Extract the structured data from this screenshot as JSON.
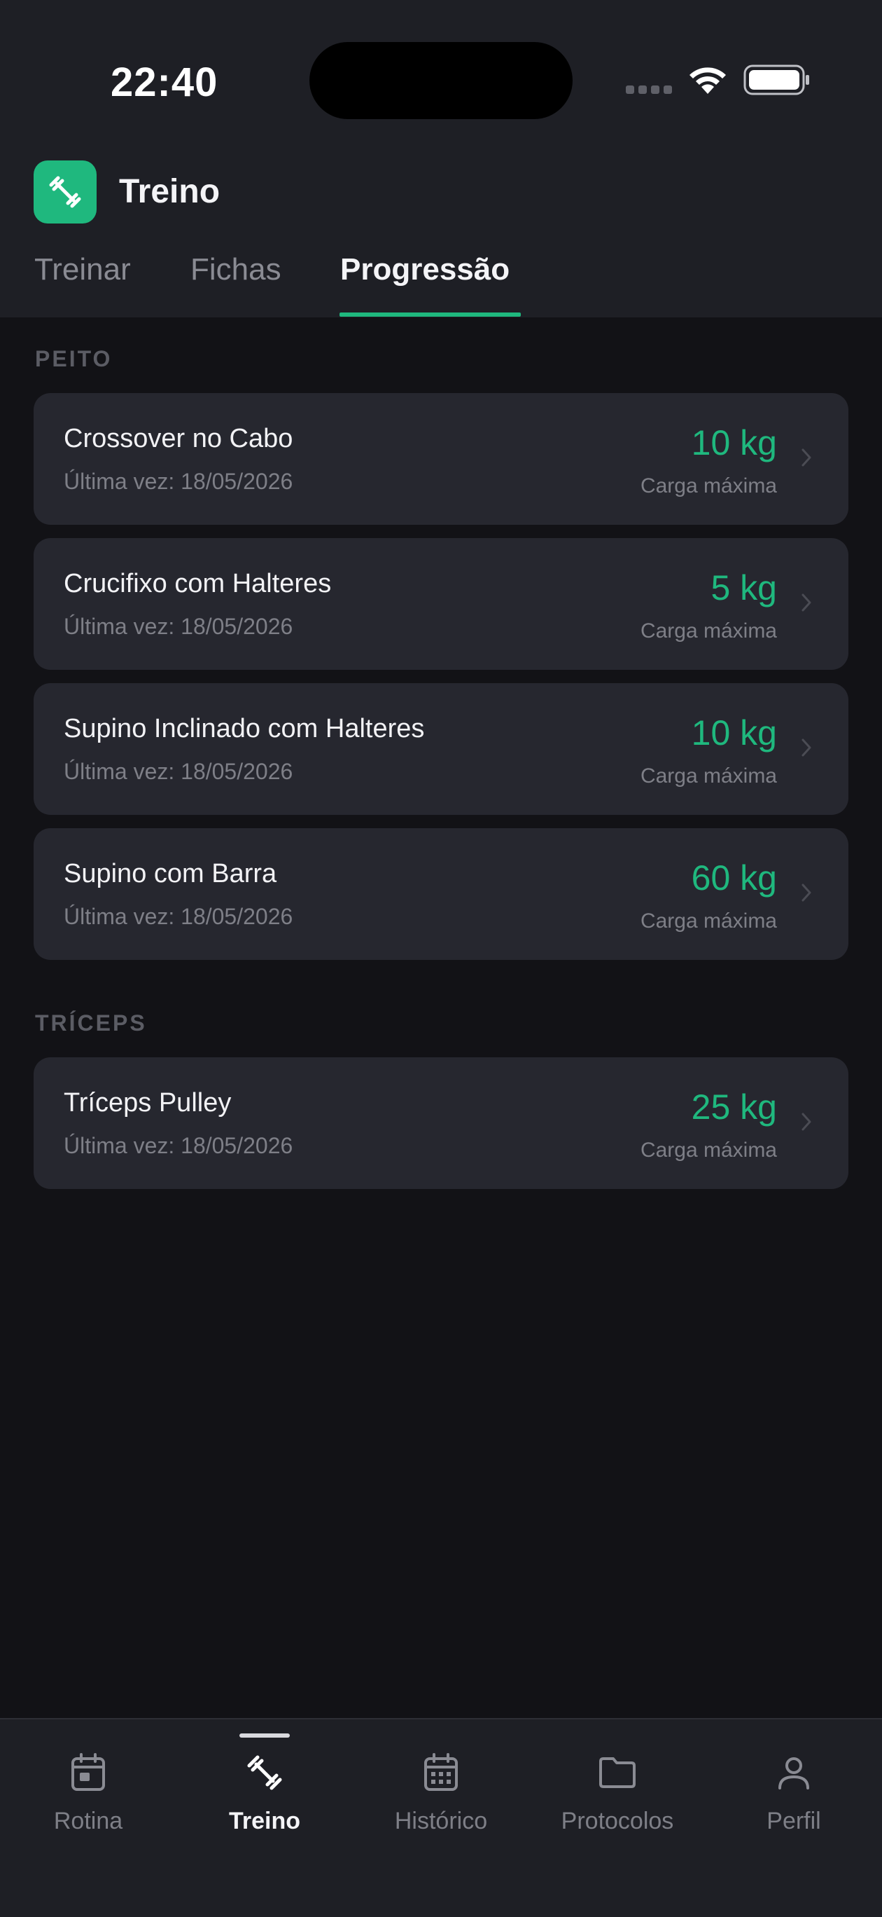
{
  "status_bar": {
    "time": "22:40"
  },
  "header": {
    "title": "Treino"
  },
  "tabs": [
    {
      "label": "Treinar"
    },
    {
      "label": "Fichas"
    },
    {
      "label": "Progressão",
      "active": true
    }
  ],
  "sections": [
    {
      "title": "PEITO",
      "exercises": [
        {
          "name": "Crossover no Cabo",
          "last": "Última vez: 18/05/2026",
          "load": "10 kg",
          "load_label": "Carga máxima"
        },
        {
          "name": "Crucifixo com Halteres",
          "last": "Última vez: 18/05/2026",
          "load": "5 kg",
          "load_label": "Carga máxima"
        },
        {
          "name": "Supino Inclinado com Halteres",
          "last": "Última vez: 18/05/2026",
          "load": "10 kg",
          "load_label": "Carga máxima"
        },
        {
          "name": "Supino com Barra",
          "last": "Última vez: 18/05/2026",
          "load": "60 kg",
          "load_label": "Carga máxima"
        }
      ]
    },
    {
      "title": "TRÍCEPS",
      "exercises": [
        {
          "name": "Tríceps Pulley",
          "last": "Última vez: 18/05/2026",
          "load": "25 kg",
          "load_label": "Carga máxima"
        }
      ]
    }
  ],
  "bottom_nav": [
    {
      "label": "Rotina",
      "icon": "calendar-day-icon"
    },
    {
      "label": "Treino",
      "icon": "dumbbell-icon",
      "active": true
    },
    {
      "label": "Histórico",
      "icon": "calendar-grid-icon"
    },
    {
      "label": "Protocolos",
      "icon": "folder-icon"
    },
    {
      "label": "Perfil",
      "icon": "user-icon"
    }
  ],
  "colors": {
    "accent": "#1fb87e",
    "background": "#121216",
    "surface": "#1e1f25",
    "card": "#26272f"
  }
}
